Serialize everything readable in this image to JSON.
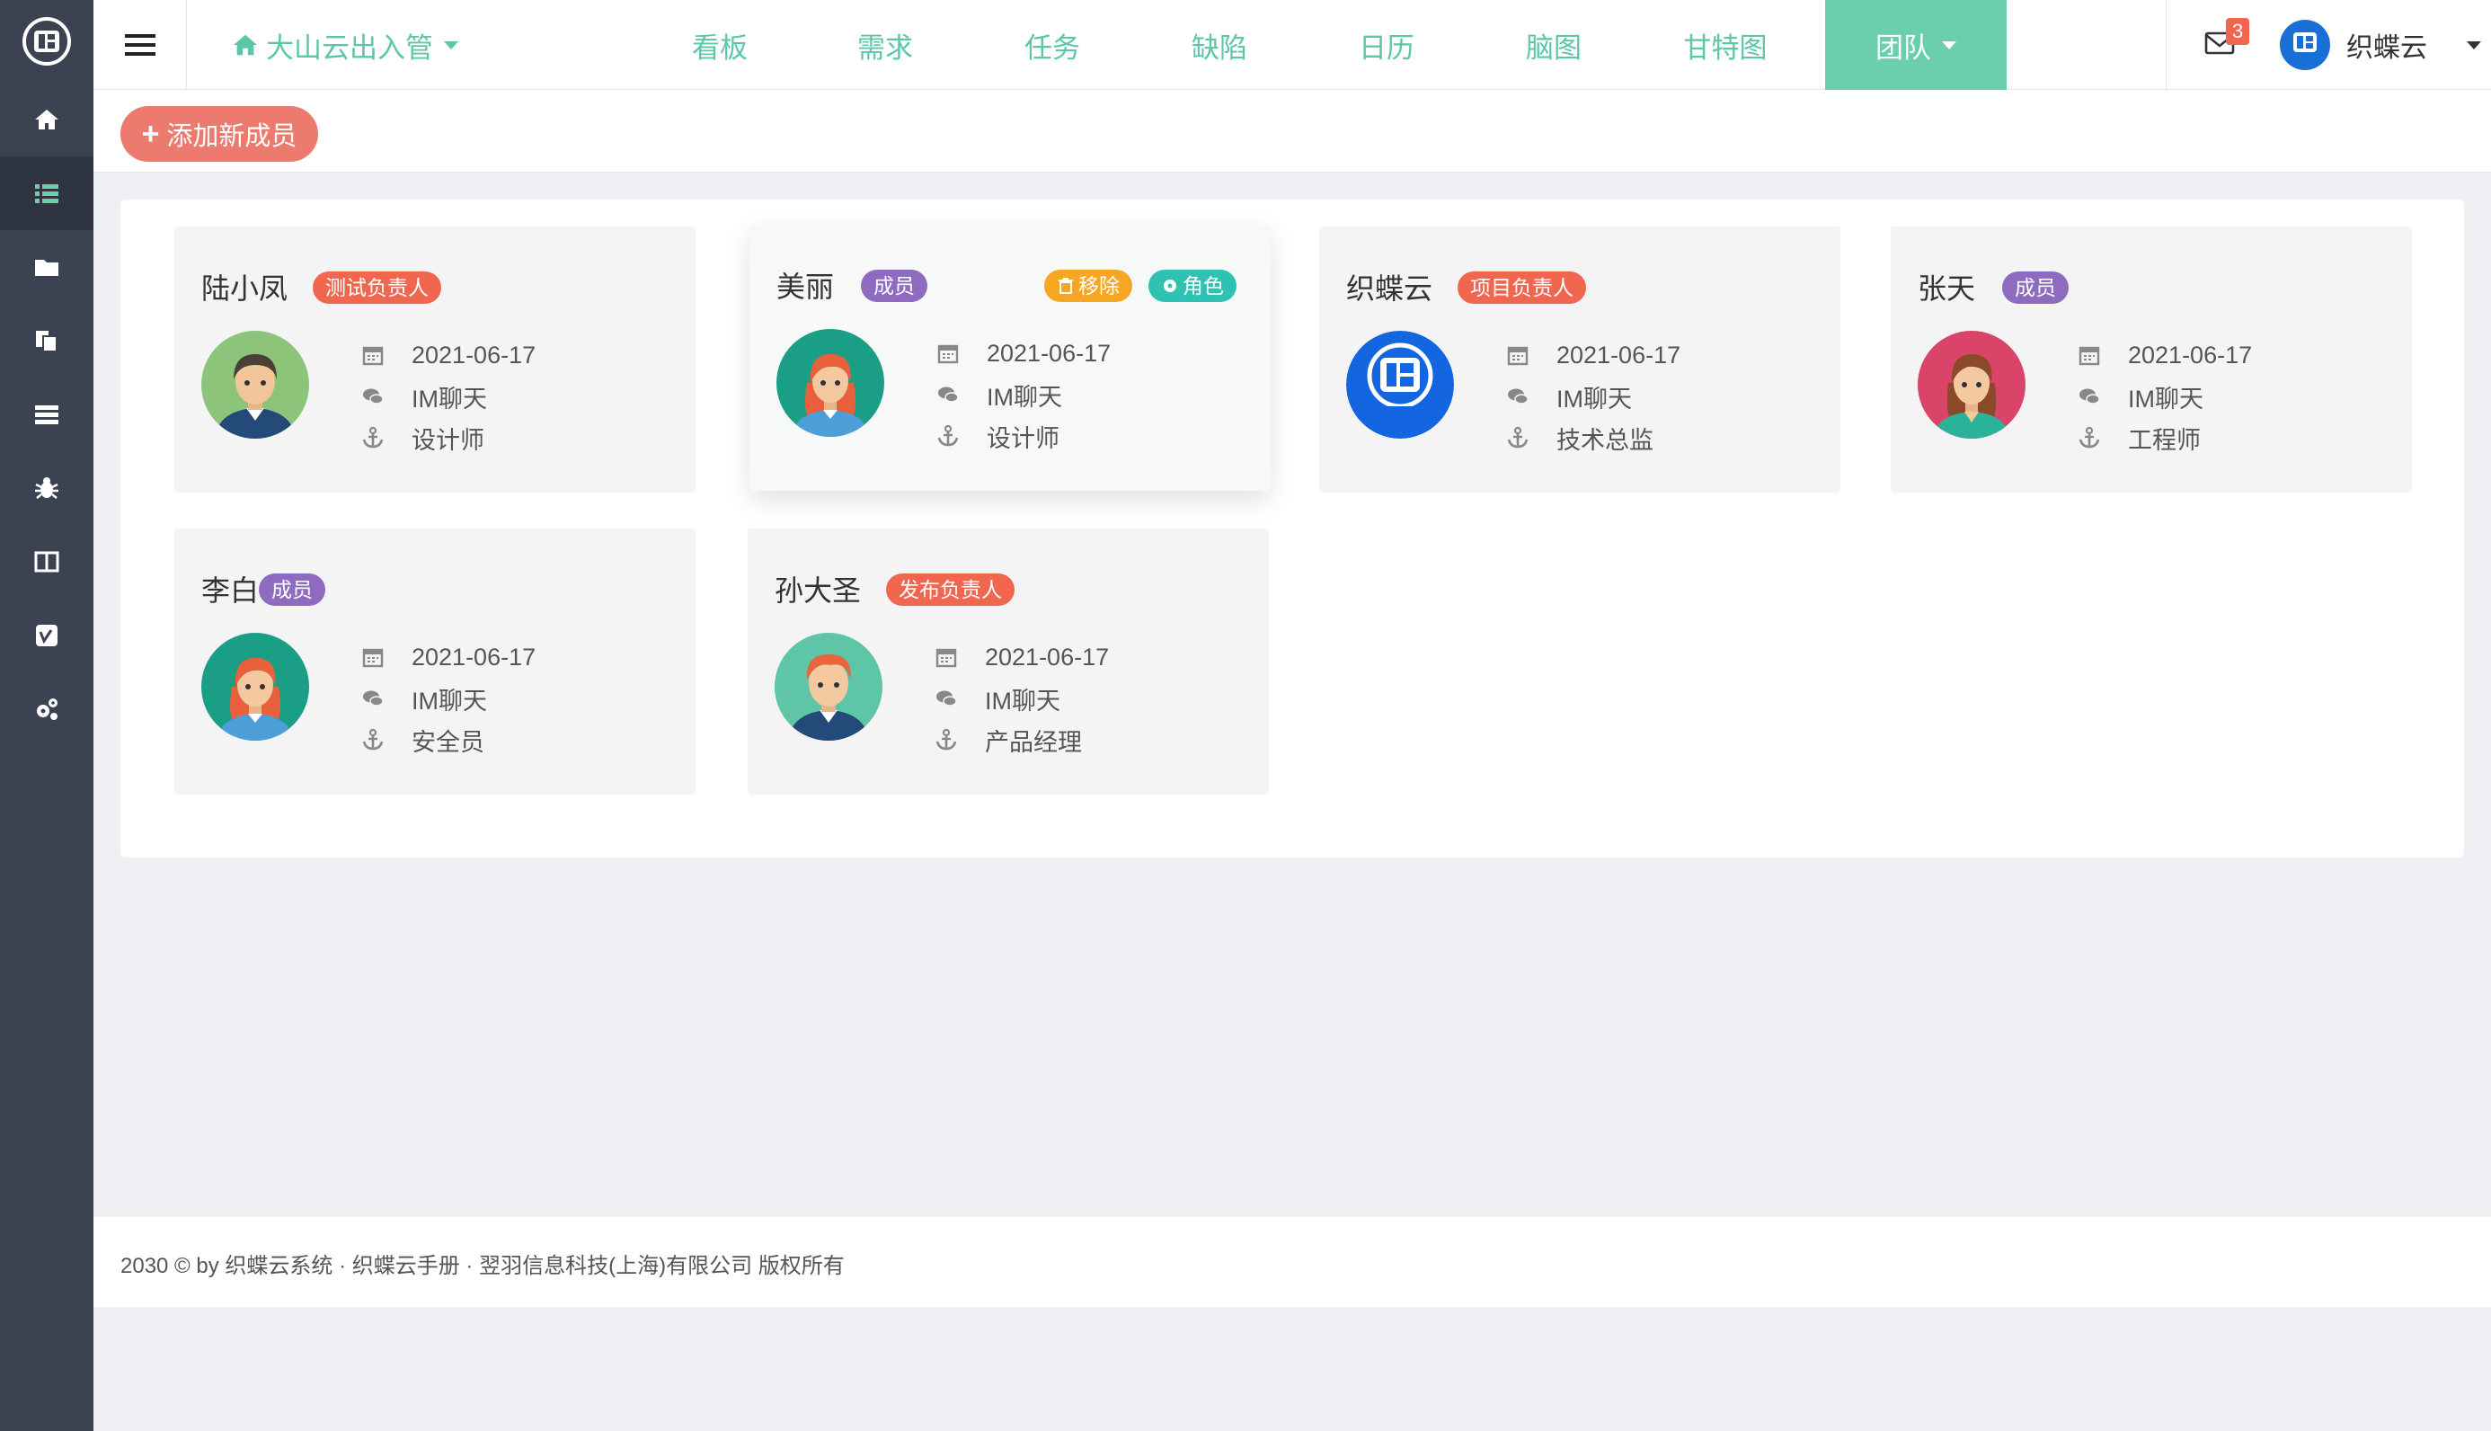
{
  "nav": {
    "project": "大山云出入管",
    "items": [
      "看板",
      "需求",
      "任务",
      "缺陷",
      "日历",
      "脑图",
      "甘特图"
    ],
    "team": "团队"
  },
  "topright": {
    "mail_count": "3",
    "user_name": "织蝶云"
  },
  "actions": {
    "add_member": "添加新成员"
  },
  "card_actions": {
    "remove": "移除",
    "role": "角色"
  },
  "members": [
    {
      "name": "陆小凤",
      "role": "测试负责人",
      "role_color": "#f1664f",
      "date": "2021-06-17",
      "chat": "IM聊天",
      "title": "设计师",
      "avatar": "man-green"
    },
    {
      "name": "美丽",
      "role": "成员",
      "role_color": "#8e6bc1",
      "date": "2021-06-17",
      "chat": "IM聊天",
      "title": "设计师",
      "avatar": "woman-teal"
    },
    {
      "name": "织蝶云",
      "role": "项目负责人",
      "role_color": "#f1664f",
      "date": "2021-06-17",
      "chat": "IM聊天",
      "title": "技术总监",
      "avatar": "logo-blue"
    },
    {
      "name": "张天",
      "role": "成员",
      "role_color": "#8e6bc1",
      "date": "2021-06-17",
      "chat": "IM聊天",
      "title": "工程师",
      "avatar": "woman-pink"
    },
    {
      "name": "李白",
      "role": "成员",
      "role_color": "#8e6bc1",
      "date": "2021-06-17",
      "chat": "IM聊天",
      "title": "安全员",
      "avatar": "woman-teal"
    },
    {
      "name": "孙大圣",
      "role": "发布负责人",
      "role_color": "#f1664f",
      "date": "2021-06-17",
      "chat": "IM聊天",
      "title": "产品经理",
      "avatar": "boy-teal"
    }
  ],
  "footer": {
    "text": "2030 © by 织蝶云系统 · 织蝶云手册 · 翌羽信息科技(上海)有限公司 版权所有"
  },
  "colors": {
    "sidebar": "#3b4252",
    "accent": "#6ccfac",
    "danger": "#f1664f",
    "purple": "#8e6bc1",
    "orange": "#f5a623",
    "teal": "#2fc2b3"
  }
}
